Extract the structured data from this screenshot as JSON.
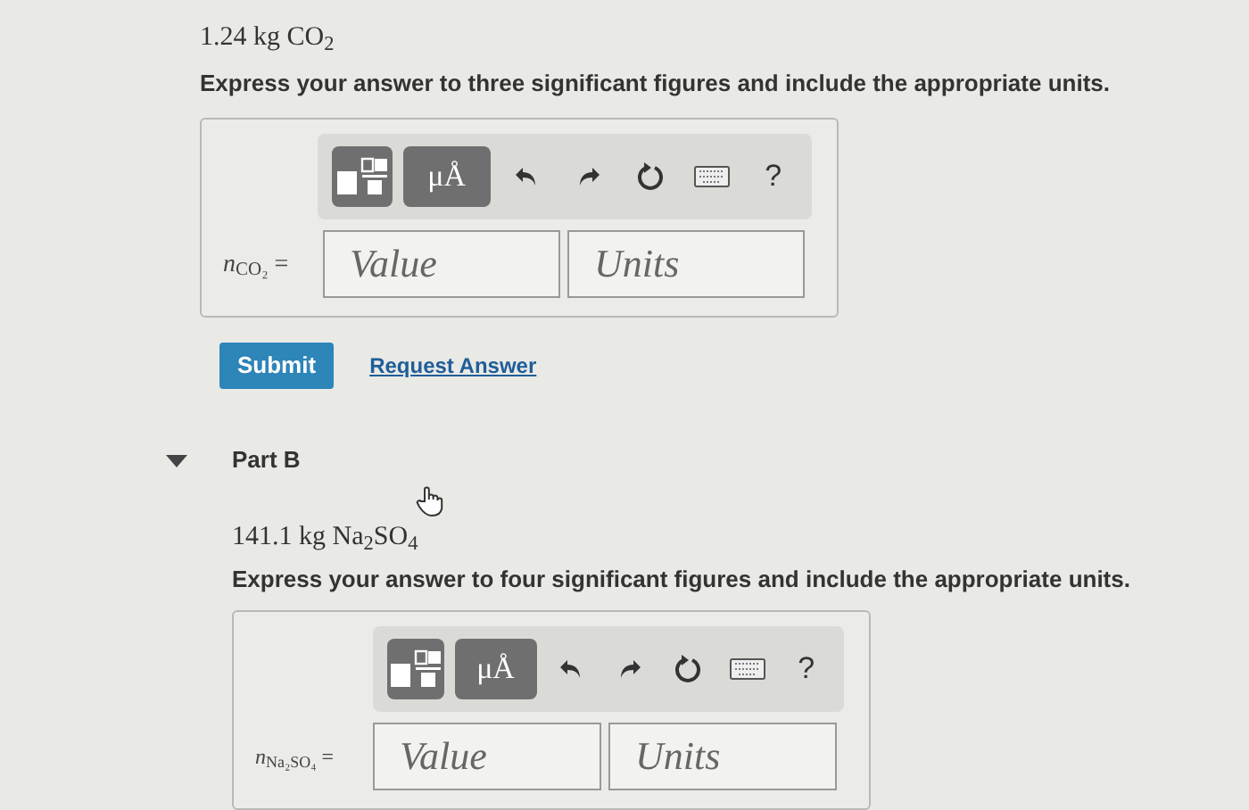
{
  "part_a": {
    "given": "1.24 kg CO$_{2}$",
    "instruction": "Express your answer to three significant figures and include the appropriate units.",
    "answer": {
      "toolbar": {
        "units_button": "μÅ",
        "help": "?"
      },
      "label": "*n*$_{CO₂}$ =",
      "value": {
        "placeholder": "Value"
      },
      "units": {
        "placeholder": "Units"
      }
    },
    "buttons": [
      {
        "kind": "submit",
        "label": "Submit"
      },
      {
        "kind": "link",
        "label": "Request Answer"
      }
    ]
  },
  "part_b": {
    "header": "Part B",
    "expanded": true,
    "given": "141.1 kg Na$_{2}$SO$_{4}$",
    "instruction": "Express your answer to four significant figures and include the appropriate units.",
    "answer": {
      "toolbar": {
        "units_button": "μÅ",
        "help": "?"
      },
      "label": "*n*$_{Na₂SO₄}$ =",
      "value": {
        "placeholder": "Value"
      },
      "units": {
        "placeholder": "Units"
      }
    }
  }
}
